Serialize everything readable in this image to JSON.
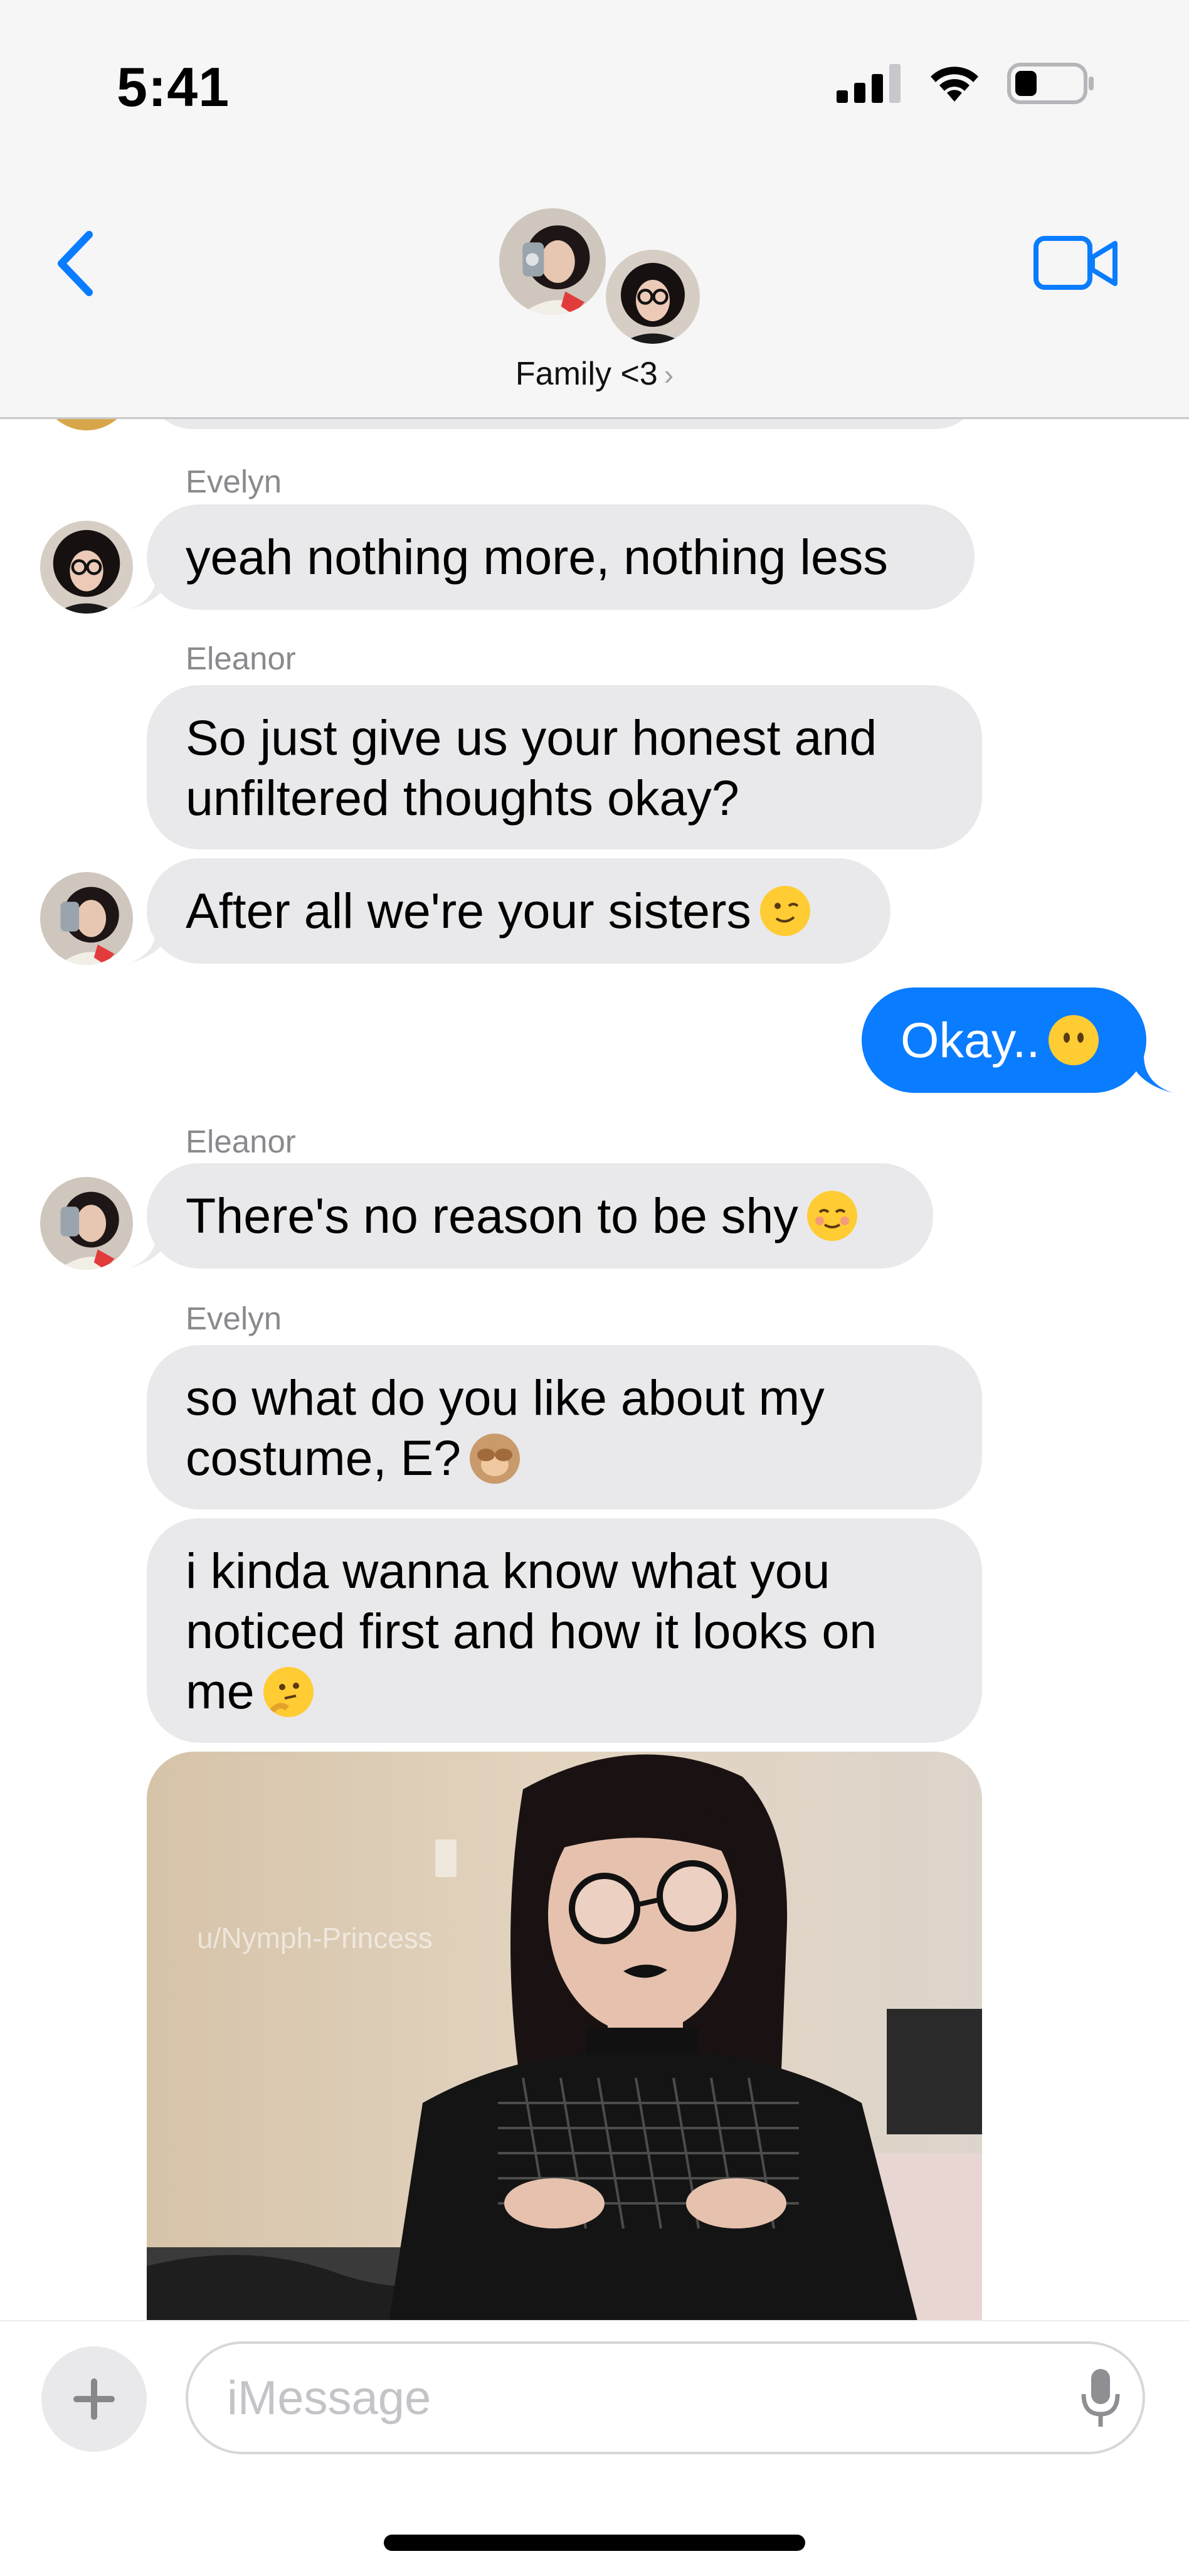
{
  "status_bar": {
    "time": "5:41"
  },
  "header": {
    "group_name": "Family <3",
    "chevron": "›"
  },
  "messages": [
    {
      "sender": "Evelyn",
      "text": "yeah nothing more, nothing less"
    },
    {
      "sender": "Eleanor",
      "text": "So just give us your honest and unfiltered thoughts okay?"
    },
    {
      "text": "After all we're your sisters",
      "emoji": "winking-face"
    },
    {
      "direction": "outgoing",
      "text": "Okay..",
      "emoji": "face-without-mouth"
    },
    {
      "sender": "Eleanor",
      "text": "There's no reason to be shy",
      "emoji": "smiling-face"
    },
    {
      "sender": "Evelyn",
      "text": "so what do you like about my costume, E?",
      "emoji": "see-no-evil-monkey"
    },
    {
      "text": "i kinda wanna know what you noticed first and how it looks on me",
      "emoji": "thinking-face"
    }
  ],
  "photo": {
    "watermark": "u/Nymph-Princess"
  },
  "input": {
    "placeholder": "iMessage"
  },
  "colors": {
    "outgoing": "#0a7cff",
    "incoming": "#e9e9eb",
    "accent": "#0a7cff"
  }
}
